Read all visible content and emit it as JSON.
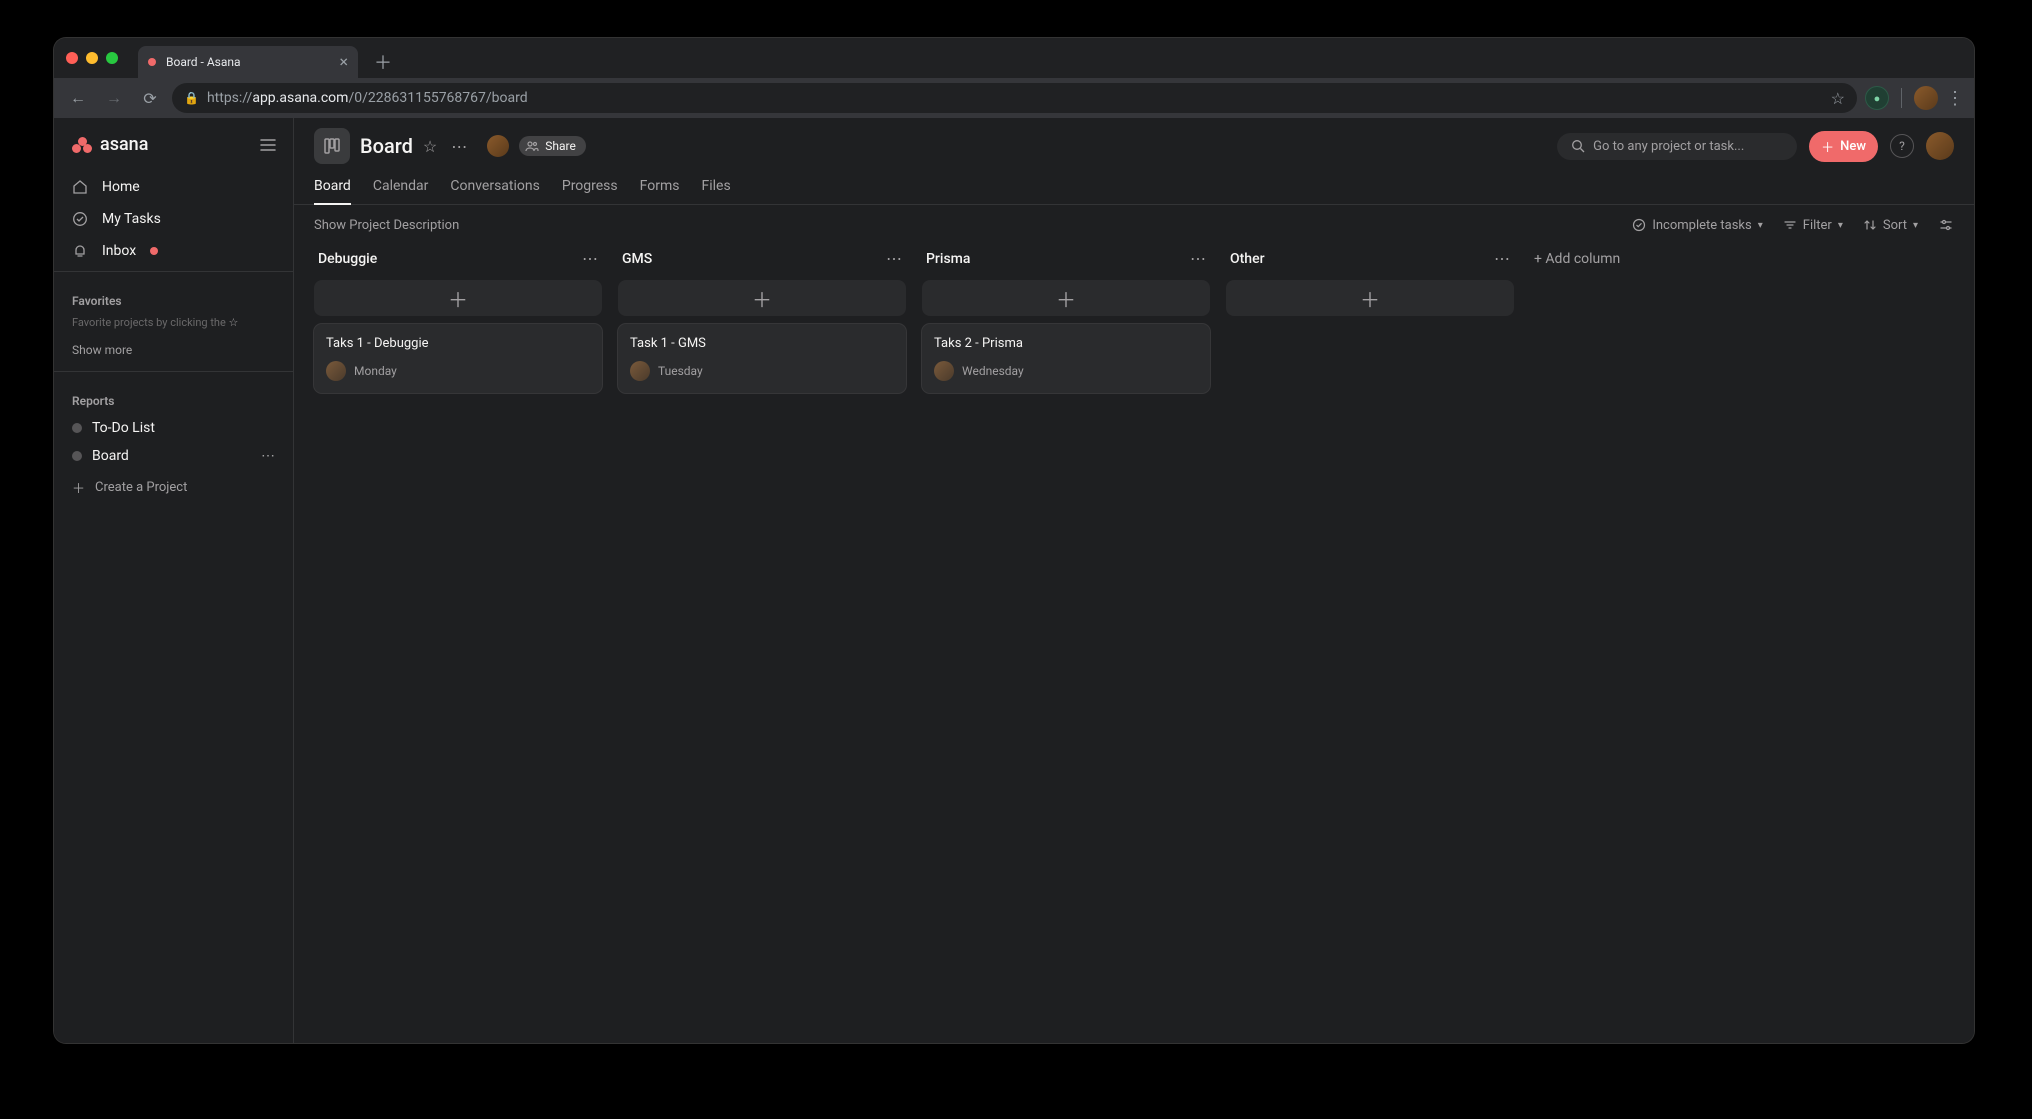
{
  "browser": {
    "tab_title": "Board - Asana",
    "url_prefix": "https://",
    "url_host": "app.asana.com",
    "url_path": "/0/228631155768767/board"
  },
  "sidebar": {
    "logo_text": "asana",
    "nav": {
      "home": "Home",
      "my_tasks": "My Tasks",
      "inbox": "Inbox"
    },
    "favorites": {
      "title": "Favorites",
      "hint_prefix": "Favorite projects by clicking the ",
      "hint_star": "☆",
      "show_more": "Show more"
    },
    "reports": {
      "title": "Reports",
      "items": [
        {
          "name": "To-Do List"
        },
        {
          "name": "Board"
        }
      ],
      "create": "Create a Project"
    }
  },
  "header": {
    "title": "Board",
    "share_label": "Share",
    "search_placeholder": "Go to any project or task...",
    "new_label": "New",
    "help_label": "?",
    "tabs": {
      "board": "Board",
      "calendar": "Calendar",
      "conversations": "Conversations",
      "progress": "Progress",
      "forms": "Forms",
      "files": "Files"
    }
  },
  "toolbar": {
    "show_desc": "Show Project Description",
    "incomplete": "Incomplete tasks",
    "filter": "Filter",
    "sort": "Sort"
  },
  "board": {
    "add_column": "+ Add column",
    "columns": [
      {
        "name": "Debuggie",
        "cards": [
          {
            "title": "Taks 1 - Debuggie",
            "due": "Monday"
          }
        ]
      },
      {
        "name": "GMS",
        "cards": [
          {
            "title": "Task 1 - GMS",
            "due": "Tuesday"
          }
        ]
      },
      {
        "name": "Prisma",
        "cards": [
          {
            "title": "Taks 2 - Prisma",
            "due": "Wednesday"
          }
        ]
      },
      {
        "name": "Other",
        "cards": []
      }
    ]
  }
}
